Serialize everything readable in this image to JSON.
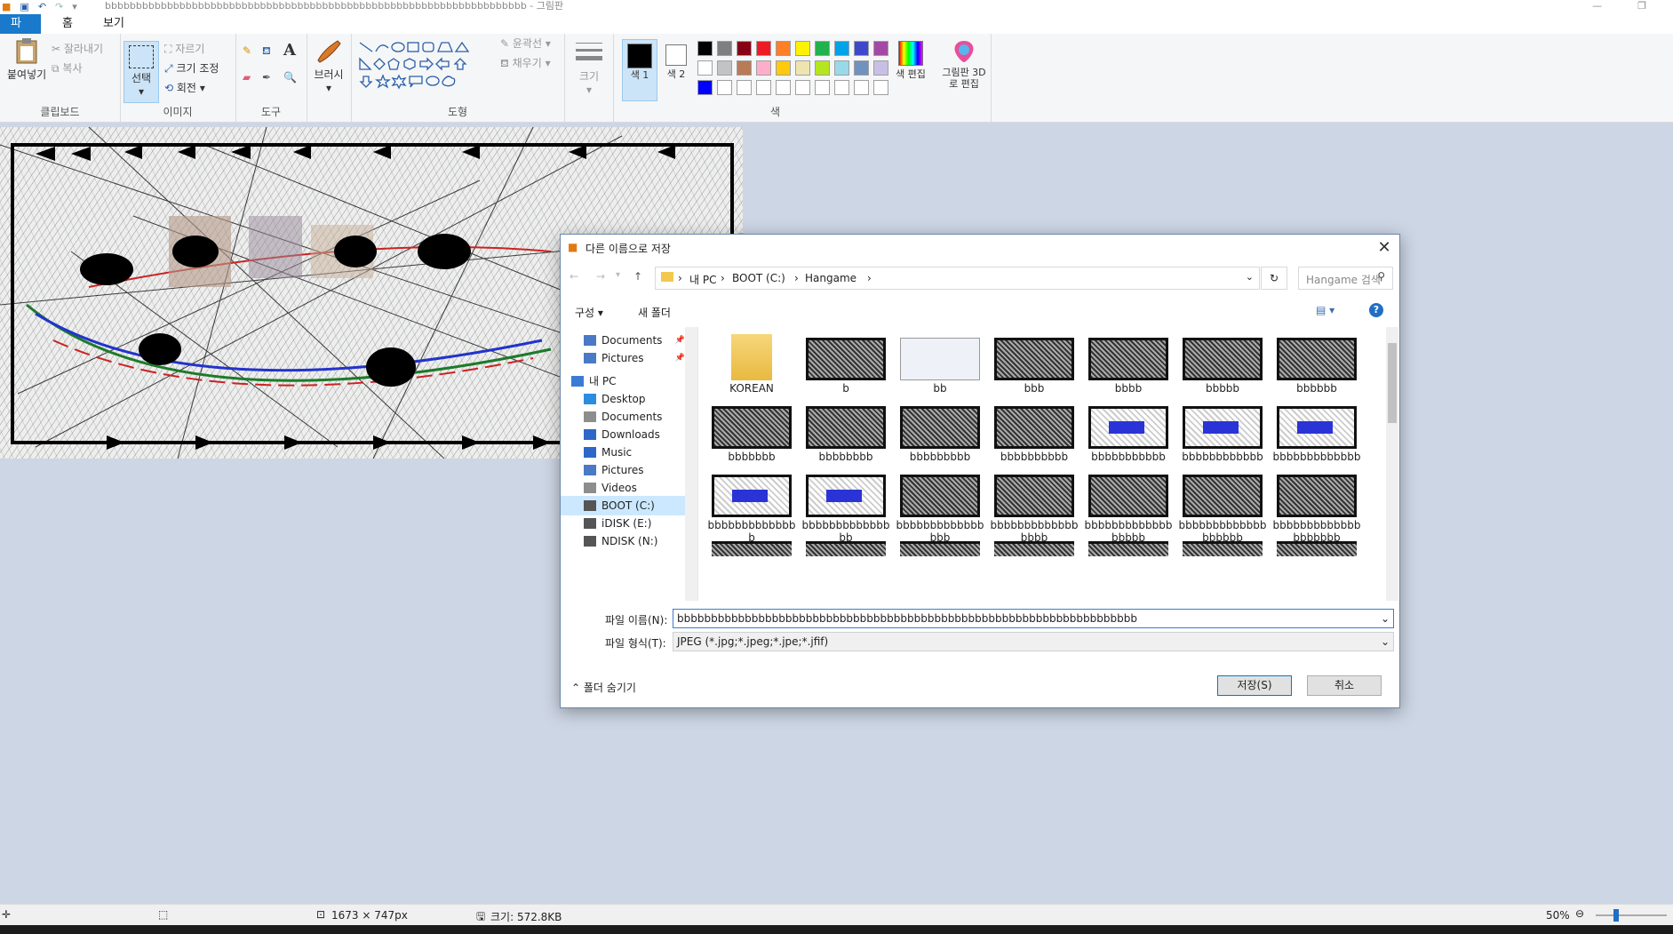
{
  "window": {
    "title": "bbbbbbbbbbbbbbbbbbbbbbbbbbbbbbbbbbbbbbbbbbbbbbbbbbbbbbbbbbbbbbbbbbbb - 그림판"
  },
  "menu": {
    "file": "파일",
    "home": "홈",
    "view": "보기"
  },
  "ribbon": {
    "clipboard": {
      "paste": "붙여넣기",
      "cut": "잘라내기",
      "copy": "복사",
      "group": "클립보드"
    },
    "image": {
      "select": "선택",
      "crop": "자르기",
      "resize": "크기 조정",
      "rotate": "회전",
      "group": "이미지"
    },
    "tools": {
      "group": "도구"
    },
    "brushes": {
      "label": "브러시"
    },
    "shapes": {
      "outline": "윤곽선",
      "fill": "채우기",
      "group": "도형"
    },
    "size": {
      "label": "크기"
    },
    "colors": {
      "color1": "색 1",
      "color2": "색 2",
      "edit": "색 편집",
      "group": "색",
      "palette_row1": [
        "#000000",
        "#7f7f7f",
        "#880015",
        "#ed1c24",
        "#ff7f27",
        "#fff200",
        "#22b14c",
        "#00a2e8",
        "#3f48cc",
        "#a349a4"
      ],
      "palette_row2": [
        "#ffffff",
        "#c3c3c3",
        "#b97a57",
        "#ffaec9",
        "#ffc90e",
        "#efe4b0",
        "#b5e61d",
        "#99d9ea",
        "#7092be",
        "#c8bfe7"
      ],
      "palette_row3": [
        "#0000ff",
        "#ffffff",
        "#ffffff",
        "#ffffff",
        "#ffffff",
        "#ffffff",
        "#ffffff",
        "#ffffff",
        "#ffffff",
        "#ffffff"
      ]
    },
    "paint3d": {
      "label": "그림판 3D로 편집"
    }
  },
  "dialog": {
    "title": "다른 이름으로 저장",
    "breadcrumb": [
      "내 PC",
      "BOOT (C:)",
      "Hangame"
    ],
    "search_placeholder": "Hangame 검색",
    "organize": "구성",
    "new_folder": "새 폴더",
    "nav": [
      {
        "label": "Documents",
        "pinned": true
      },
      {
        "label": "Pictures",
        "pinned": true
      },
      {
        "label": "내 PC"
      },
      {
        "label": "Desktop"
      },
      {
        "label": "Documents"
      },
      {
        "label": "Downloads"
      },
      {
        "label": "Music"
      },
      {
        "label": "Pictures"
      },
      {
        "label": "Videos"
      },
      {
        "label": "BOOT (C:)"
      },
      {
        "label": "iDISK (E:)"
      },
      {
        "label": "NDISK (N:)"
      }
    ],
    "files": [
      "KOREAN",
      "b",
      "bb",
      "bbb",
      "bbbb",
      "bbbbb",
      "bbbbbb",
      "bbbbbbb",
      "bbbbbbbb",
      "bbbbbbbbb",
      "bbbbbbbbbb",
      "bbbbbbbbbbb",
      "bbbbbbbbbbbb",
      "bbbbbbbbbbbbb",
      "bbbbbbbbbbbbbb",
      "bbbbbbbbbbbbbbb",
      "bbbbbbbbbbbbbbbb",
      "bbbbbbbbbbbbbbbbb",
      "bbbbbbbbbbbbbbbbbb",
      "bbbbbbbbbbbbbbbbbbb",
      "bbbbbbbbbbbbbbbbbbbb"
    ],
    "filename_label": "파일 이름(N):",
    "filename_value": "bbbbbbbbbbbbbbbbbbbbbbbbbbbbbbbbbbbbbbbbbbbbbbbbbbbbbbbbbbbbbbbbbbbb",
    "filetype_label": "파일 형식(T):",
    "filetype_value": "JPEG (*.jpg;*.jpeg;*.jpe;*.jfif)",
    "hide_folders": "폴더 숨기기",
    "save": "저장(S)",
    "cancel": "취소"
  },
  "status": {
    "dimensions": "1673 × 747px",
    "size": "크기: 572.8KB",
    "zoom": "50%"
  }
}
